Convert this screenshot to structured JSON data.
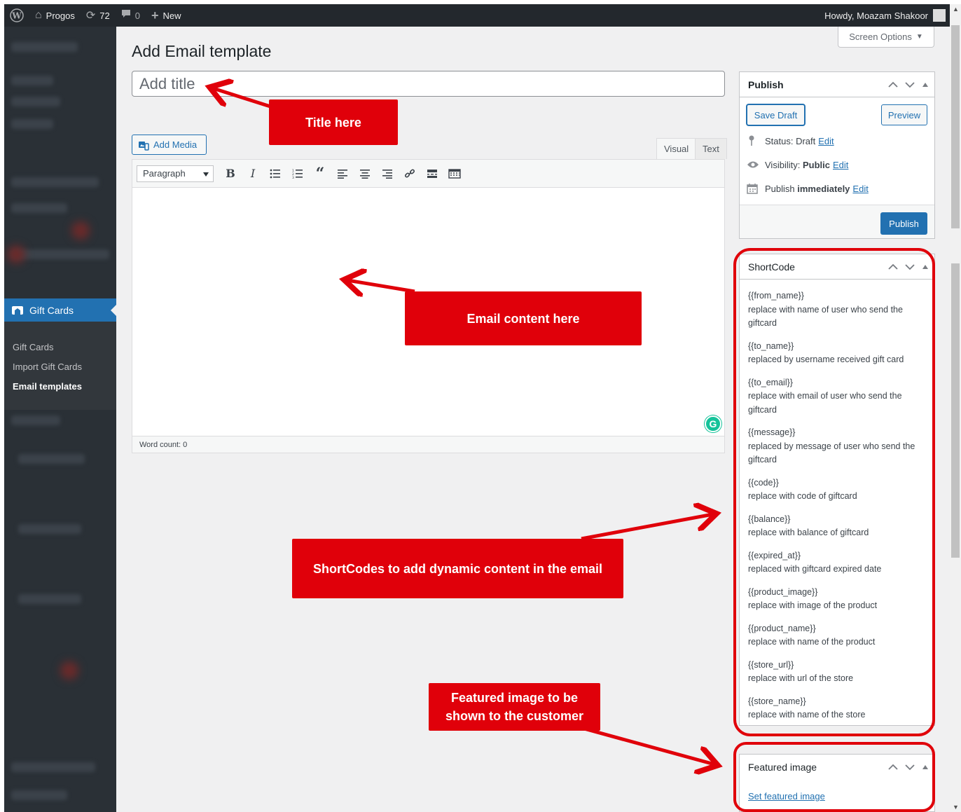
{
  "admin_bar": {
    "site_name": "Progos",
    "updates_count": "72",
    "comments_count": "0",
    "new_label": "New",
    "greeting": "Howdy, Moazam Shakoor"
  },
  "sidebar": {
    "current_menu": "Gift Cards",
    "submenu": [
      {
        "label": "Gift Cards",
        "current": false
      },
      {
        "label": "Import Gift Cards",
        "current": false
      },
      {
        "label": "Email templates",
        "current": true
      }
    ]
  },
  "screen_options_label": "Screen Options",
  "page_title": "Add Email template",
  "title_placeholder": "Add title",
  "editor": {
    "add_media_label": "Add Media",
    "tabs": [
      "Visual",
      "Text"
    ],
    "active_tab": "Visual",
    "format_value": "Paragraph",
    "toolbar_icons": [
      "bold-icon",
      "italic-icon",
      "bullet-list-icon",
      "numbered-list-icon",
      "blockquote-icon",
      "align-left-icon",
      "align-center-icon",
      "align-right-icon",
      "link-icon",
      "read-more-icon",
      "toolbar-toggle-icon"
    ],
    "word_count": "Word count: 0"
  },
  "publish": {
    "title": "Publish",
    "save_draft": "Save Draft",
    "preview": "Preview",
    "status_label": "Status:",
    "status_value": "Draft",
    "visibility_label": "Visibility:",
    "visibility_value": "Public",
    "publish_label": "Publish",
    "publish_value": "immediately",
    "edit_label": "Edit",
    "publish_button": "Publish"
  },
  "shortcode_box": {
    "title": "ShortCode",
    "items": [
      {
        "code": "{{from_name}}",
        "desc": "replace with name of user who send the giftcard"
      },
      {
        "code": "{{to_name}}",
        "desc": "replaced by username received gift card"
      },
      {
        "code": "{{to_email}}",
        "desc": "replace with email of user who send the giftcard"
      },
      {
        "code": "{{message}}",
        "desc": "replaced by message of user who send the giftcard"
      },
      {
        "code": "{{code}}",
        "desc": "replace with code of giftcard"
      },
      {
        "code": "{{balance}}",
        "desc": "replace with balance of giftcard"
      },
      {
        "code": "{{expired_at}}",
        "desc": "replaced with giftcard expired date"
      },
      {
        "code": "{{product_image}}",
        "desc": "replace with image of the product"
      },
      {
        "code": "{{product_name}}",
        "desc": "replace with name of the product"
      },
      {
        "code": "{{store_url}}",
        "desc": "replace with url of the store"
      },
      {
        "code": "{{store_name}}",
        "desc": "replace with name of the store"
      }
    ]
  },
  "featured_box": {
    "title": "Featured image",
    "link": "Set featured image"
  },
  "annotations": {
    "title_here": "Title here",
    "email_content_here": "Email content here",
    "shortcodes_note": "ShortCodes to add dynamic content in the email",
    "featured_line1": "Featured image to be",
    "featured_line2": "shown to the customer",
    "color": "#e0000a"
  },
  "colors": {
    "admin_bar": "#23282d",
    "sidebar": "#2a3036",
    "accent": "#2271b1"
  }
}
